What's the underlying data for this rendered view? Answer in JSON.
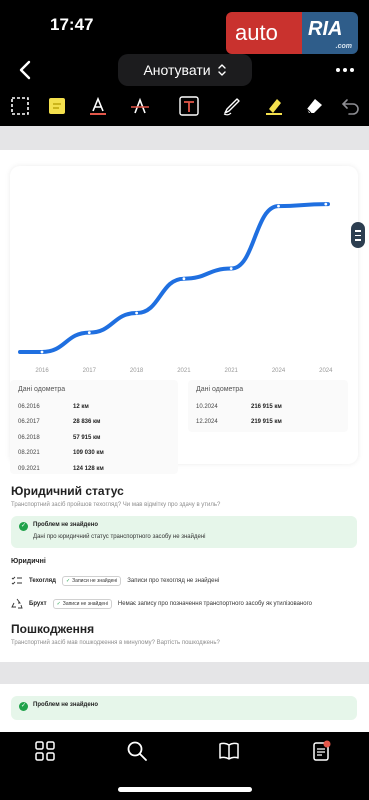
{
  "status_bar": {
    "time": "17:47"
  },
  "logo": {
    "auto": "auto",
    "ria": "RIA",
    "domain": ".com"
  },
  "nav": {
    "title": "Анотувати"
  },
  "chart_data": {
    "type": "line",
    "categories": [
      "2016",
      "2017",
      "2018",
      "2021",
      "2021",
      "2024",
      "2024"
    ],
    "series": [
      {
        "values": [
          12,
          28836,
          57915,
          109030,
          124128,
          216915,
          219915
        ]
      }
    ],
    "ylim": [
      0,
      235000
    ],
    "color": "#1f6fe0",
    "grid": false
  },
  "odometer_left": {
    "heading": "Дані одометра",
    "rows": [
      {
        "date": "06.2016",
        "value": "12 км"
      },
      {
        "date": "06.2017",
        "value": "28 836 км"
      },
      {
        "date": "06.2018",
        "value": "57 915 км"
      },
      {
        "date": "08.2021",
        "value": "109 030 км"
      },
      {
        "date": "09.2021",
        "value": "124 128 км"
      }
    ]
  },
  "odometer_right": {
    "heading": "Дані одометра",
    "rows": [
      {
        "date": "10.2024",
        "value": "216 915 км"
      },
      {
        "date": "12.2024",
        "value": "219 915 км"
      }
    ]
  },
  "legal": {
    "title": "Юридичний статус",
    "subtitle": "Транспортний засіб пройшов техогляд? Чи мав відмітку про здачу в утиль?",
    "notice_title": "Проблем не знайдено",
    "notice_text": "Дані про юридичний статус транспортного засобу не знайдені",
    "group_label": "Юридичні",
    "rows": [
      {
        "label": "Техогляд",
        "badge": "Записи не знайдені",
        "text": "Записи про техогляд не знайдені"
      },
      {
        "label": "Брухт",
        "badge": "Записи не знайдені",
        "text": "Немає запису про позначення транспортного засобу як утилізованого"
      }
    ]
  },
  "damage": {
    "title": "Пошкодження",
    "subtitle": "Транспортний засіб мав пошкодження в минулому? Вартість пошкоджень?"
  },
  "next_page": {
    "notice_title": "Проблем не знайдено"
  },
  "colors": {
    "accent_green": "#1fa24a",
    "line_blue": "#1f6fe0",
    "logo_red": "#c9322e",
    "logo_blue": "#2f5d8a",
    "notification": "#e4574a"
  }
}
